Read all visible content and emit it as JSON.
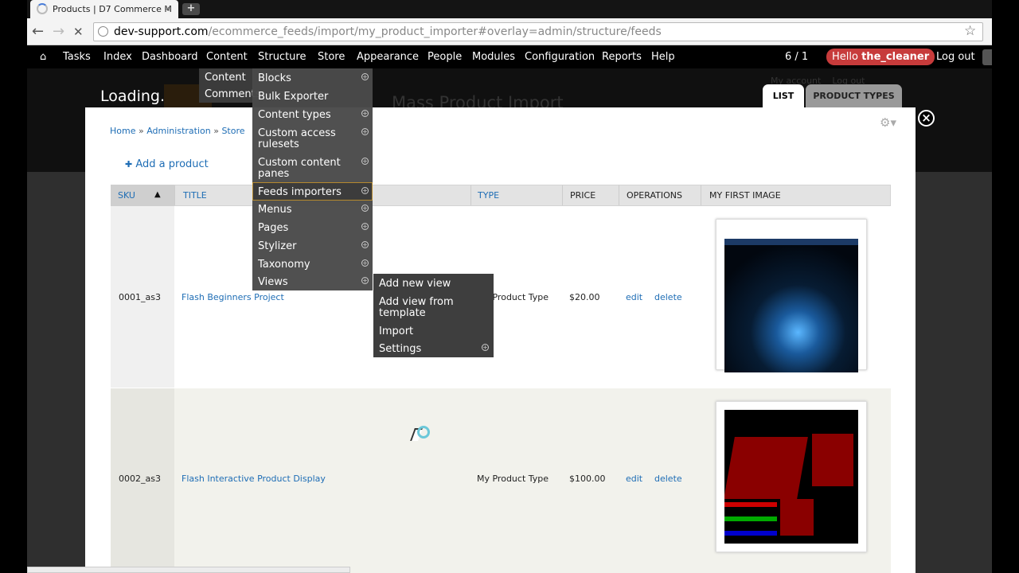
{
  "browser": {
    "tab_title": "Products | D7 Commerce M",
    "tab_close": "×",
    "new_tab": "+",
    "back": "←",
    "forward": "→",
    "reload": "✕",
    "url_host": "dev-support.com",
    "url_path": "/ecommerce_feeds/import/my_product_importer#overlay=admin/structure/feeds",
    "star": "☆"
  },
  "admin_menu": {
    "home_icon": "⌂",
    "items": [
      "Tasks",
      "Index",
      "Dashboard",
      "Content",
      "Structure",
      "Store",
      "Appearance",
      "People",
      "Modules",
      "Configuration",
      "Reports",
      "Help"
    ],
    "counter": "6 / 1",
    "hello_prefix": "Hello ",
    "username": "the_cleaner",
    "logout": "Log out"
  },
  "background_page": {
    "loading": "Loading.",
    "title": "Mass Product Import",
    "my_account": "My account",
    "log_out": "Log out"
  },
  "overlay": {
    "tabs": [
      "LIST",
      "PRODUCT TYPES"
    ],
    "close": "×",
    "gear": "⚙▾",
    "breadcrumb": [
      "Home",
      "Administration",
      "Store"
    ],
    "breadcrumb_sep": " » ",
    "add_product": "Add a product",
    "add_icon": "✚"
  },
  "table": {
    "columns": [
      "SKU",
      "TITLE",
      "TYPE",
      "PRICE",
      "OPERATIONS",
      "MY FIRST IMAGE"
    ],
    "sort_indicator": "▲",
    "rows": [
      {
        "sku": "0001_as3",
        "title": "Flash Beginners Project",
        "type": "My Product Type",
        "price": "$20.00",
        "edit": "edit",
        "delete": "delete"
      },
      {
        "sku": "0002_as3",
        "title": "Flash Interactive Product Display",
        "type": "My Product Type",
        "price": "$100.00",
        "edit": "edit",
        "delete": "delete"
      }
    ]
  },
  "content_submenu": [
    "Content",
    "Comments"
  ],
  "structure_submenu": [
    "Blocks",
    "Bulk Exporter",
    "Content types",
    "Custom access rulesets",
    "Custom content panes",
    "Feeds importers",
    "Menus",
    "Pages",
    "Stylizer",
    "Taxonomy",
    "Views"
  ],
  "views_submenu": [
    "Add new view",
    "Add view from template",
    "Import",
    "Settings"
  ],
  "colors": {
    "link": "#1e6db5",
    "hello_badge": "#c73b3b",
    "menu_bg": "#4a4a4a",
    "highlight_border": "#b5892e"
  }
}
